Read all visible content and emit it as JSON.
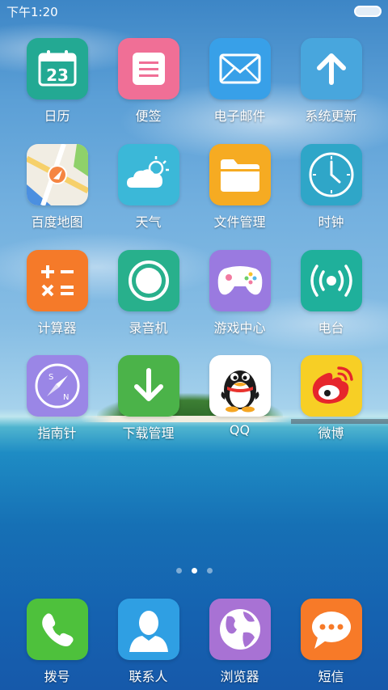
{
  "status_bar": {
    "time": "下午1:20"
  },
  "apps": [
    {
      "label": "日历",
      "icon": "calendar-icon",
      "color": "#23a993",
      "calendar_day": "23"
    },
    {
      "label": "便签",
      "icon": "notes-icon",
      "color": "#f06f96"
    },
    {
      "label": "电子邮件",
      "icon": "mail-icon",
      "color": "#38a0e8"
    },
    {
      "label": "系统更新",
      "icon": "update-arrow-icon",
      "color": "#48a6dd"
    },
    {
      "label": "百度地图",
      "icon": "map-icon",
      "color": "#f1ede3"
    },
    {
      "label": "天气",
      "icon": "weather-icon",
      "color": "#3bb8d8"
    },
    {
      "label": "文件管理",
      "icon": "folder-icon",
      "color": "#f6ab22"
    },
    {
      "label": "时钟",
      "icon": "clock-icon",
      "color": "#2fa6c8"
    },
    {
      "label": "计算器",
      "icon": "calculator-icon",
      "color": "#f57a29"
    },
    {
      "label": "录音机",
      "icon": "record-icon",
      "color": "#28b08c"
    },
    {
      "label": "游戏中心",
      "icon": "gamepad-icon",
      "color": "#9a7ae0"
    },
    {
      "label": "电台",
      "icon": "radio-icon",
      "color": "#1fb09b"
    },
    {
      "label": "指南针",
      "icon": "compass-icon",
      "color": "#9a86e6"
    },
    {
      "label": "下载管理",
      "icon": "download-icon",
      "color": "#4bb349"
    },
    {
      "label": "QQ",
      "icon": "qq-penguin-icon",
      "color": "#ffffff"
    },
    {
      "label": "微博",
      "icon": "weibo-icon",
      "color": "#f7cf25"
    }
  ],
  "dock": [
    {
      "label": "拨号",
      "icon": "phone-icon",
      "color": "#4ec13c"
    },
    {
      "label": "联系人",
      "icon": "contacts-icon",
      "color": "#2f9fe3"
    },
    {
      "label": "浏览器",
      "icon": "browser-globe-icon",
      "color": "#a872d4"
    },
    {
      "label": "短信",
      "icon": "message-icon",
      "color": "#f77a28"
    }
  ],
  "page_indicator": {
    "pages": 3,
    "current": 2
  }
}
